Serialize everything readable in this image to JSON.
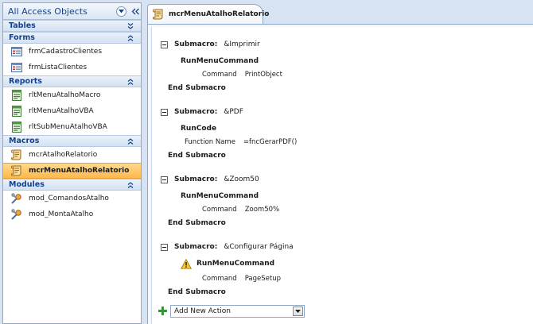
{
  "nav": {
    "title": "All Access Objects",
    "groups": [
      {
        "label": "Tables",
        "items": []
      },
      {
        "label": "Forms",
        "items": [
          {
            "label": "frmCadastroClientes"
          },
          {
            "label": "frmListaClientes"
          }
        ]
      },
      {
        "label": "Reports",
        "items": [
          {
            "label": "rltMenuAtalhoMacro"
          },
          {
            "label": "rltMenuAtalhoVBA"
          },
          {
            "label": "rltSubMenuAtalhoVBA"
          }
        ]
      },
      {
        "label": "Macros",
        "items": [
          {
            "label": "mcrAtalhoRelatorio"
          },
          {
            "label": "mcrMenuAtalhoRelatorio"
          }
        ]
      },
      {
        "label": "Modules",
        "items": [
          {
            "label": "mod_ComandosAtalho"
          },
          {
            "label": "mod_MontaAtalho"
          }
        ]
      }
    ]
  },
  "tab": {
    "label": "mcrMenuAtalhoRelatorio"
  },
  "macro": {
    "submacro_keyword": "Submacro:",
    "end_keyword": "End Submacro",
    "submacros": [
      {
        "name": "&Imprimir",
        "action": "RunMenuCommand",
        "arg_label": "Command",
        "arg_value": "PrintObject"
      },
      {
        "name": "&PDF",
        "action": "RunCode",
        "arg_label": "Function Name",
        "arg_value": "=fncGerarPDF()"
      },
      {
        "name": "&Zoom50",
        "action": "RunMenuCommand",
        "arg_label": "Command",
        "arg_value": "Zoom50%"
      },
      {
        "name": "&Configurar Página",
        "action": "RunMenuCommand",
        "arg_label": "Command",
        "arg_value": "PageSetup"
      }
    ],
    "add_new_action": "Add New Action"
  },
  "colors": {
    "accent": "#15428b",
    "selection": "#ffc35e",
    "border": "#8fa7c8"
  }
}
